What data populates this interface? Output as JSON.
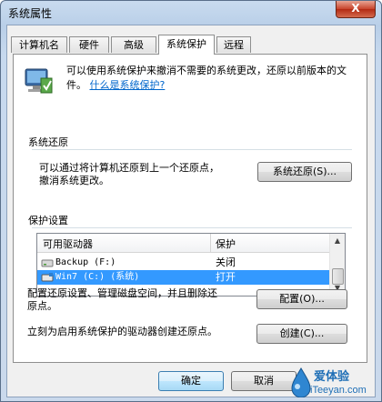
{
  "window": {
    "title": "系统属性",
    "close_glyph": "X"
  },
  "tabs": [
    {
      "label": "计算机名"
    },
    {
      "label": "硬件"
    },
    {
      "label": "高级"
    },
    {
      "label": "系统保护"
    },
    {
      "label": "远程"
    }
  ],
  "intro": {
    "text": "可以使用系统保护来撤消不需要的系统更改，还原以前版本的文件。",
    "link": "什么是系统保护?"
  },
  "restore": {
    "heading": "系统还原",
    "line1": "可以通过将计算机还原到上一个还原点，",
    "line2": "撤消系统更改。",
    "button": "系统还原(S)..."
  },
  "protection": {
    "heading": "保护设置",
    "columns": [
      "可用驱动器",
      "保护"
    ],
    "rows": [
      {
        "drive": "Backup (F:)",
        "status": "关闭"
      },
      {
        "drive": "Win7 (C:) (系统)",
        "status": "打开"
      }
    ],
    "config_text_line1": "配置还原设置、管理磁盘空间，并且删除还",
    "config_text_line2": "原点。",
    "config_button": "配置(O)...",
    "create_text": "立刻为启用系统保护的驱动器创建还原点。",
    "create_button": "创建(C)..."
  },
  "footer": {
    "ok": "确定",
    "cancel": "取消"
  },
  "watermark": {
    "top": "爱体验",
    "bottom": "iTeeyan.com"
  }
}
